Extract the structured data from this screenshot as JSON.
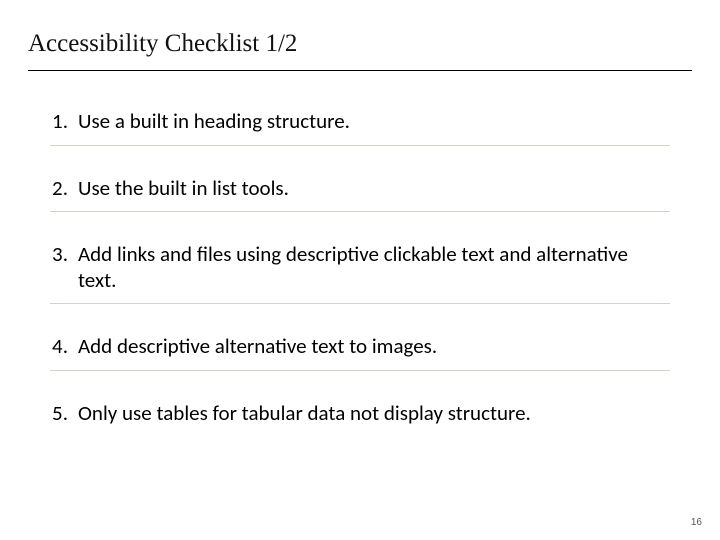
{
  "title": "Accessibility Checklist 1/2",
  "items": [
    {
      "n": "1.",
      "text": "Use a built in heading structure."
    },
    {
      "n": "2.",
      "text": "Use the built in list tools."
    },
    {
      "n": "3.",
      "text": "Add links and files using descriptive clickable text and alternative text."
    },
    {
      "n": "4.",
      "text": "Add descriptive alternative text to images."
    },
    {
      "n": "5.",
      "text": "Only use tables for tabular data not display structure."
    }
  ],
  "page_number": "16"
}
